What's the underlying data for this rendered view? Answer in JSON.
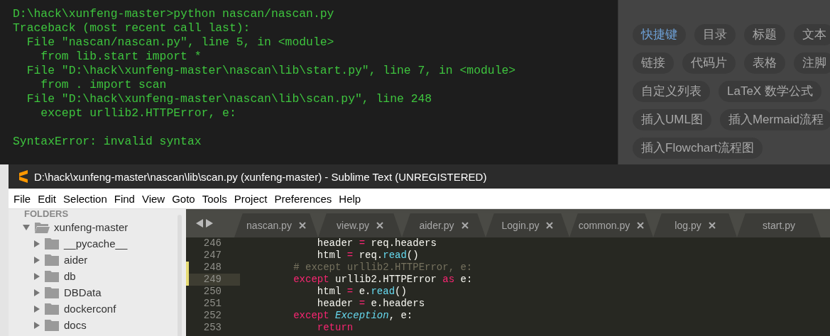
{
  "terminal": {
    "lines": [
      {
        "text": "D:\\hack\\xunfeng-master>python nascan/nascan.py",
        "gap_before": false
      },
      {
        "text": "Traceback (most recent call last):",
        "gap_before": false
      },
      {
        "text": "  File \"nascan/nascan.py\", line 5, in <module>",
        "gap_before": false
      },
      {
        "text": "    from lib.start import *",
        "gap_before": false
      },
      {
        "text": "  File \"D:\\hack\\xunfeng-master\\nascan\\lib\\start.py\", line 7, in <module>",
        "gap_before": false
      },
      {
        "text": "    from . import scan",
        "gap_before": false
      },
      {
        "text": "  File \"D:\\hack\\xunfeng-master\\nascan\\lib\\scan.py\", line 248",
        "gap_before": false
      },
      {
        "text": "    except urllib2.HTTPError, e:",
        "gap_before": false
      },
      {
        "text": "SyntaxError: invalid syntax",
        "gap_before": true
      }
    ]
  },
  "help_panel": {
    "rows": [
      [
        {
          "label": "快捷键",
          "selected": true
        },
        {
          "label": "目录",
          "selected": false
        },
        {
          "label": "标题",
          "selected": false
        },
        {
          "label": "文本",
          "selected": false
        }
      ],
      [
        {
          "label": "链接",
          "selected": false
        },
        {
          "label": "代码片",
          "selected": false
        },
        {
          "label": "表格",
          "selected": false
        },
        {
          "label": "注脚",
          "selected": false
        }
      ],
      [
        {
          "label": "自定义列表",
          "selected": false
        },
        {
          "label": "LaTeX 数学公式",
          "selected": false
        }
      ],
      [
        {
          "label": "插入UML图",
          "selected": false
        },
        {
          "label": "插入Mermaid流程",
          "selected": false
        }
      ],
      [
        {
          "label": "插入Flowchart流程图",
          "selected": false
        }
      ]
    ]
  },
  "window": {
    "title": "D:\\hack\\xunfeng-master\\nascan\\lib\\scan.py (xunfeng-master) - Sublime Text (UNREGISTERED)"
  },
  "menu": [
    "File",
    "Edit",
    "Selection",
    "Find",
    "View",
    "Goto",
    "Tools",
    "Project",
    "Preferences",
    "Help"
  ],
  "sidebar": {
    "heading": "FOLDERS",
    "items": [
      {
        "label": "xunfeng-master",
        "expanded": true,
        "children": [
          {
            "label": "__pycache__",
            "expanded": false
          },
          {
            "label": "aider",
            "expanded": false
          },
          {
            "label": "db",
            "expanded": false
          },
          {
            "label": "DBData",
            "expanded": false
          },
          {
            "label": "dockerconf",
            "expanded": false
          },
          {
            "label": "docs",
            "expanded": false
          }
        ]
      }
    ]
  },
  "tabs": [
    {
      "label": "nascan.py",
      "selected": false
    },
    {
      "label": "view.py",
      "selected": false
    },
    {
      "label": "aider.py",
      "selected": false
    },
    {
      "label": "Login.py",
      "selected": false
    },
    {
      "label": "common.py",
      "selected": false
    },
    {
      "label": "log.py",
      "selected": false
    },
    {
      "label": "start.py",
      "selected": false
    }
  ],
  "code": [
    {
      "number": "246",
      "current": false,
      "modified": false,
      "tokens": [
        {
          "text": "            header ",
          "kind": "plain"
        },
        {
          "text": "=",
          "kind": "keyword"
        },
        {
          "text": " req.headers",
          "kind": "plain"
        }
      ]
    },
    {
      "number": "247",
      "current": false,
      "modified": false,
      "tokens": [
        {
          "text": "            html ",
          "kind": "plain"
        },
        {
          "text": "=",
          "kind": "keyword"
        },
        {
          "text": " req.",
          "kind": "plain"
        },
        {
          "text": "read",
          "kind": "function"
        },
        {
          "text": "()",
          "kind": "plain"
        }
      ]
    },
    {
      "number": "248",
      "current": false,
      "modified": true,
      "tokens": [
        {
          "text": "        # except urllib2.HTTPError, e:",
          "kind": "comment"
        }
      ]
    },
    {
      "number": "249",
      "current": true,
      "modified": true,
      "tokens": [
        {
          "text": "        except",
          "kind": "keyword"
        },
        {
          "text": " urllib2.HTTPError ",
          "kind": "plain"
        },
        {
          "text": "as",
          "kind": "keyword"
        },
        {
          "text": " e:",
          "kind": "plain"
        }
      ]
    },
    {
      "number": "250",
      "current": false,
      "modified": false,
      "tokens": [
        {
          "text": "            html ",
          "kind": "plain"
        },
        {
          "text": "=",
          "kind": "keyword"
        },
        {
          "text": " e.",
          "kind": "plain"
        },
        {
          "text": "read",
          "kind": "function"
        },
        {
          "text": "()",
          "kind": "plain"
        }
      ]
    },
    {
      "number": "251",
      "current": false,
      "modified": false,
      "tokens": [
        {
          "text": "            header ",
          "kind": "plain"
        },
        {
          "text": "=",
          "kind": "keyword"
        },
        {
          "text": " e.headers",
          "kind": "plain"
        }
      ]
    },
    {
      "number": "252",
      "current": false,
      "modified": false,
      "tokens": [
        {
          "text": "        except ",
          "kind": "keyword"
        },
        {
          "text": "Exception",
          "kind": "class"
        },
        {
          "text": ", e:",
          "kind": "plain"
        }
      ]
    },
    {
      "number": "253",
      "current": false,
      "modified": false,
      "tokens": [
        {
          "text": "            return",
          "kind": "keyword"
        }
      ]
    }
  ]
}
